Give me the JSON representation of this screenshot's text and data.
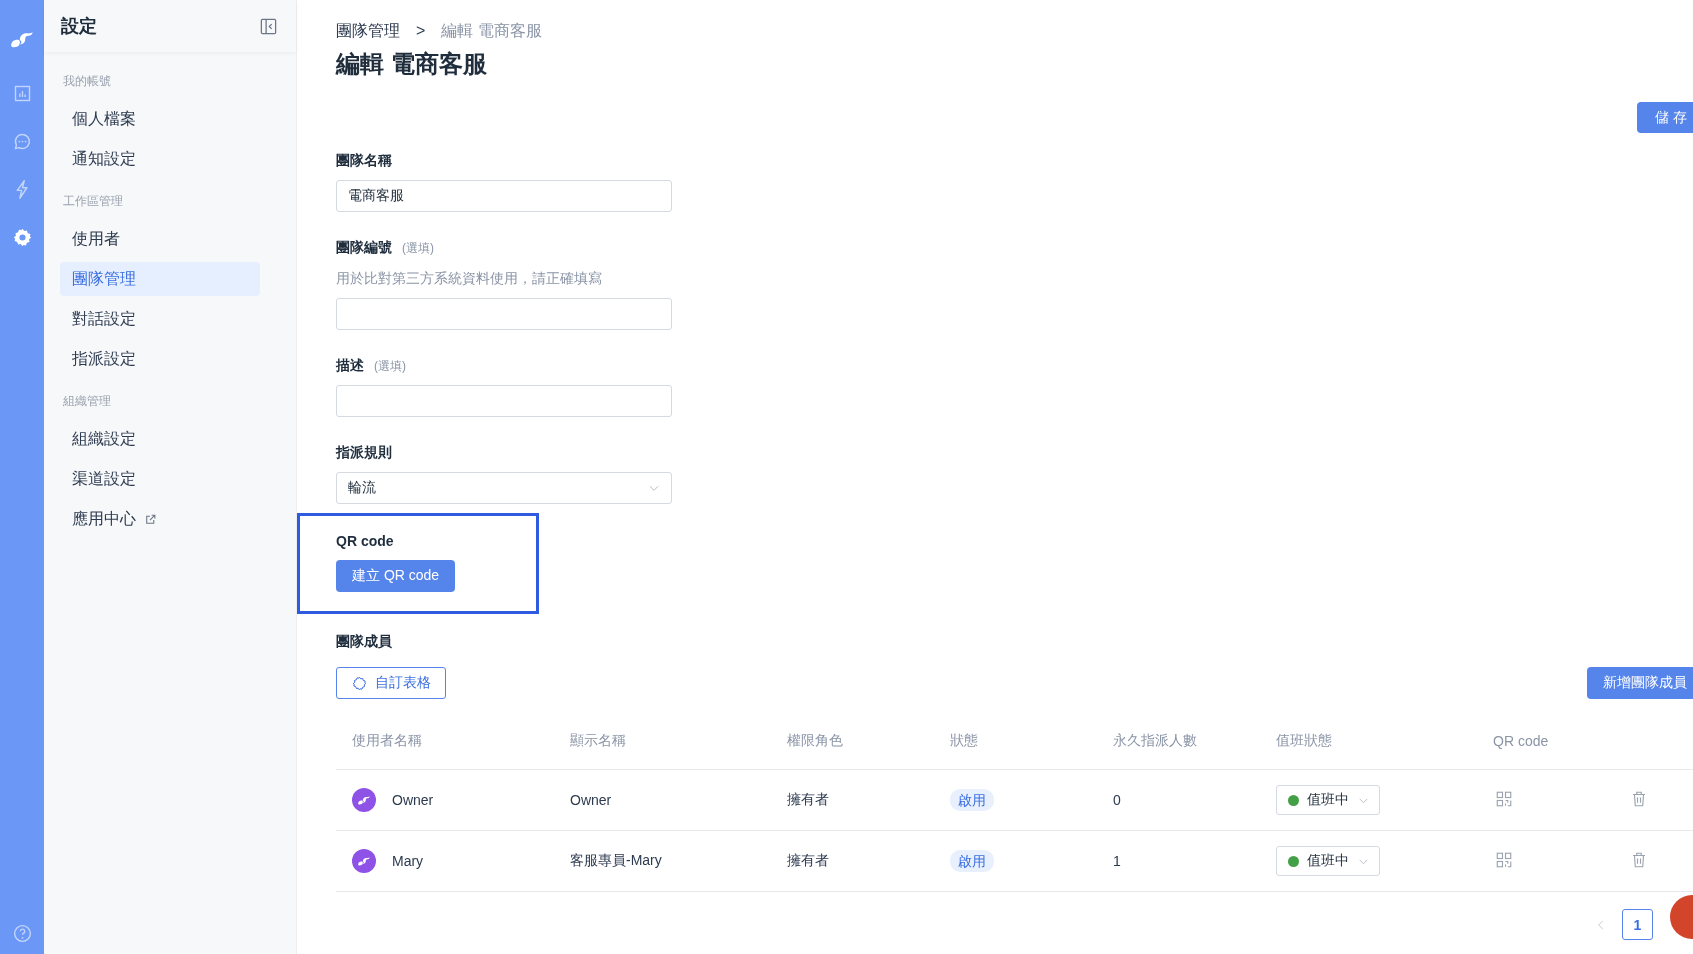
{
  "rail": {
    "items": [
      {
        "kind": "logo"
      },
      {
        "kind": "chart",
        "selected": false
      },
      {
        "kind": "chat",
        "selected": false
      },
      {
        "kind": "bolt",
        "selected": false
      },
      {
        "kind": "gear",
        "selected": true
      },
      {
        "kind": "help",
        "selected": false
      }
    ]
  },
  "sidebar": {
    "title": "設定",
    "groups": [
      {
        "label": "我的帳號",
        "items": [
          {
            "label": "個人檔案",
            "selected": false,
            "external": false
          },
          {
            "label": "通知設定",
            "selected": false,
            "external": false
          }
        ]
      },
      {
        "label": "工作區管理",
        "items": [
          {
            "label": "使用者",
            "selected": false,
            "external": false
          },
          {
            "label": "團隊管理",
            "selected": true,
            "external": false
          },
          {
            "label": "對話設定",
            "selected": false,
            "external": false
          },
          {
            "label": "指派設定",
            "selected": false,
            "external": false
          }
        ]
      },
      {
        "label": "組織管理",
        "items": [
          {
            "label": "組織設定",
            "selected": false,
            "external": false
          },
          {
            "label": "渠道設定",
            "selected": false,
            "external": false
          },
          {
            "label": "應用中心",
            "selected": false,
            "external": true
          }
        ]
      }
    ]
  },
  "breadcrumb": {
    "items": [
      "團隊管理",
      "編輯 電商客服"
    ],
    "separator": ">"
  },
  "page_title": "編輯 電商客服",
  "save_button": "儲 存",
  "fields": [
    {
      "kind": "text",
      "label": "團隊名稱",
      "value": "電商客服"
    },
    {
      "kind": "text",
      "label": "團隊編號",
      "note": "(選填)",
      "hint": "用於比對第三方系統資料使用，請正確填寫"
    },
    {
      "kind": "text",
      "label": "描述",
      "note": "(選填)"
    },
    {
      "kind": "select",
      "label": "指派規則",
      "value": "輪流"
    }
  ],
  "qr_code": {
    "label": "QR code",
    "button": "建立 QR code",
    "highlighted": true
  },
  "members": {
    "label": "團隊成員",
    "customize_button": "自訂表格",
    "add_button": "新增團隊成員",
    "columns": [
      "使用者名稱",
      "顯示名稱",
      "權限角色",
      "狀態",
      "永久指派人數",
      "值班狀態",
      "QR code"
    ],
    "rows": [
      {
        "username": "Owner",
        "display_name": "Owner",
        "role": "擁有者",
        "status": "啟用",
        "permanent_count": "0",
        "duty": {
          "label": "值班中",
          "color": "#43a047"
        }
      },
      {
        "username": "Mary",
        "display_name": "客服專員-Mary",
        "role": "擁有者",
        "status": "啟用",
        "permanent_count": "1",
        "duty": {
          "label": "值班中",
          "color": "#43a047"
        }
      }
    ]
  },
  "pagination": {
    "pages": [
      {
        "label": "1",
        "selected": true
      }
    ]
  }
}
